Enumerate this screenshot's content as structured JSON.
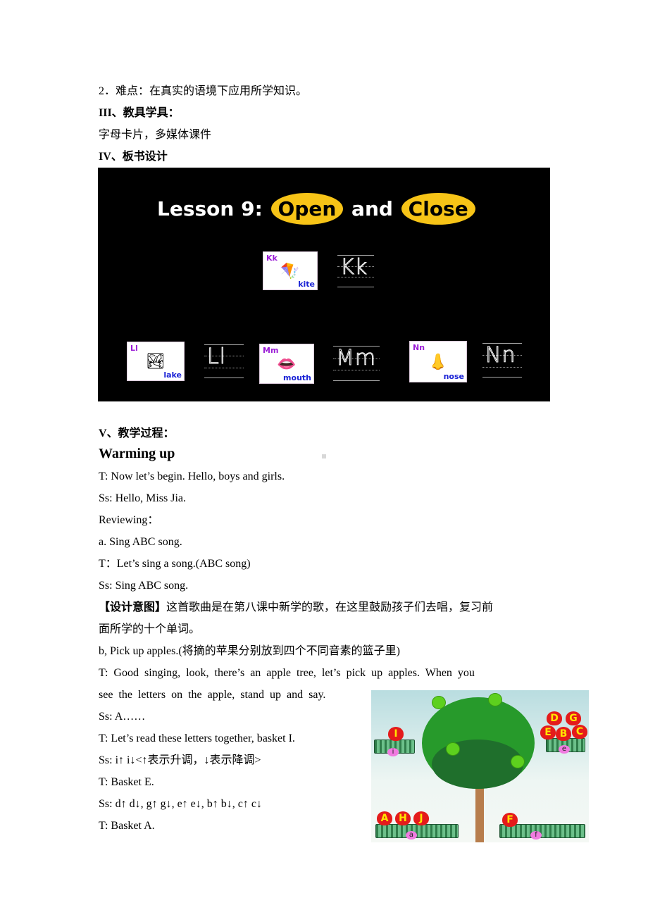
{
  "section2": {
    "difficulty_line": "2．难点：在真实的语境下应用所学知识。",
    "teaching_aids_heading": "III、教具学具：",
    "teaching_aids": "字母卡片，多媒体课件",
    "board_heading": "IV、板书设计"
  },
  "board": {
    "title_prefix": "Lesson 9:",
    "open": "Open",
    "and": "and",
    "close": "Close",
    "cards": [
      {
        "letter": "Kk",
        "word": "kite",
        "picture": "kite-icon",
        "glyph": "🪁",
        "writing": "Kk"
      },
      {
        "letter": "Ll",
        "word": "lake",
        "picture": "lake-icon",
        "glyph": "🏞",
        "writing": "Ll"
      },
      {
        "letter": "Mm",
        "word": "mouth",
        "picture": "mouth-icon",
        "glyph": "👄",
        "writing": "Mm"
      },
      {
        "letter": "Nn",
        "word": "nose",
        "picture": "nose-icon",
        "glyph": "👃",
        "writing": "Nn"
      }
    ]
  },
  "process": {
    "heading": "V、教学过程：",
    "warming_up": "Warming  up",
    "lines": [
      "T:  Now  let’s  begin.  Hello,  boys  and  girls.",
      "Ss:  Hello,  Miss  Jia.",
      "Reviewing：",
      "a.  Sing  ABC  song.",
      "T：Let’s  sing  a  song.(ABC  song)",
      "Ss:  Sing  ABC  song."
    ],
    "design_intent_label": "【设计意图】",
    "design_intent_text": "这首歌曲是在第八课中新学的歌，在这里鼓励孩子们去唱，复习前",
    "design_intent_cont": "面所学的十个单词。",
    "pick_line": "b,  Pick  up  apples.(将摘的苹果分别放到四个不同音素的篮子里)",
    "teacher_line1": "T:  Good  singing,  look,  there’s  an  apple  tree,  let’s  pick  up  apples.  When  you",
    "teacher_line2": "see  the  letters  on  the  apple,  stand  up  and  say.",
    "dialog": [
      "Ss:  A……",
      "T:  Let’s  read  these  letters  together,  basket  I.",
      "Ss:  i↑  i↓<↑表示升调，↓表示降调>",
      "T:  Basket  E.",
      "Ss:  d↑  d↓,  g↑  g↓,  e↑  e↓,  b↑  b↓,  c↑  c↓",
      "T:  Basket  A."
    ]
  },
  "apple_tree": {
    "baskets": [
      {
        "sound": "i",
        "apples": [
          "I"
        ]
      },
      {
        "sound": "e",
        "apples": [
          "D",
          "G",
          "E",
          "B",
          "C"
        ]
      },
      {
        "sound": "a",
        "apples": [
          "A",
          "H",
          "J"
        ]
      },
      {
        "sound": "f",
        "apples": [
          "F"
        ]
      }
    ]
  }
}
